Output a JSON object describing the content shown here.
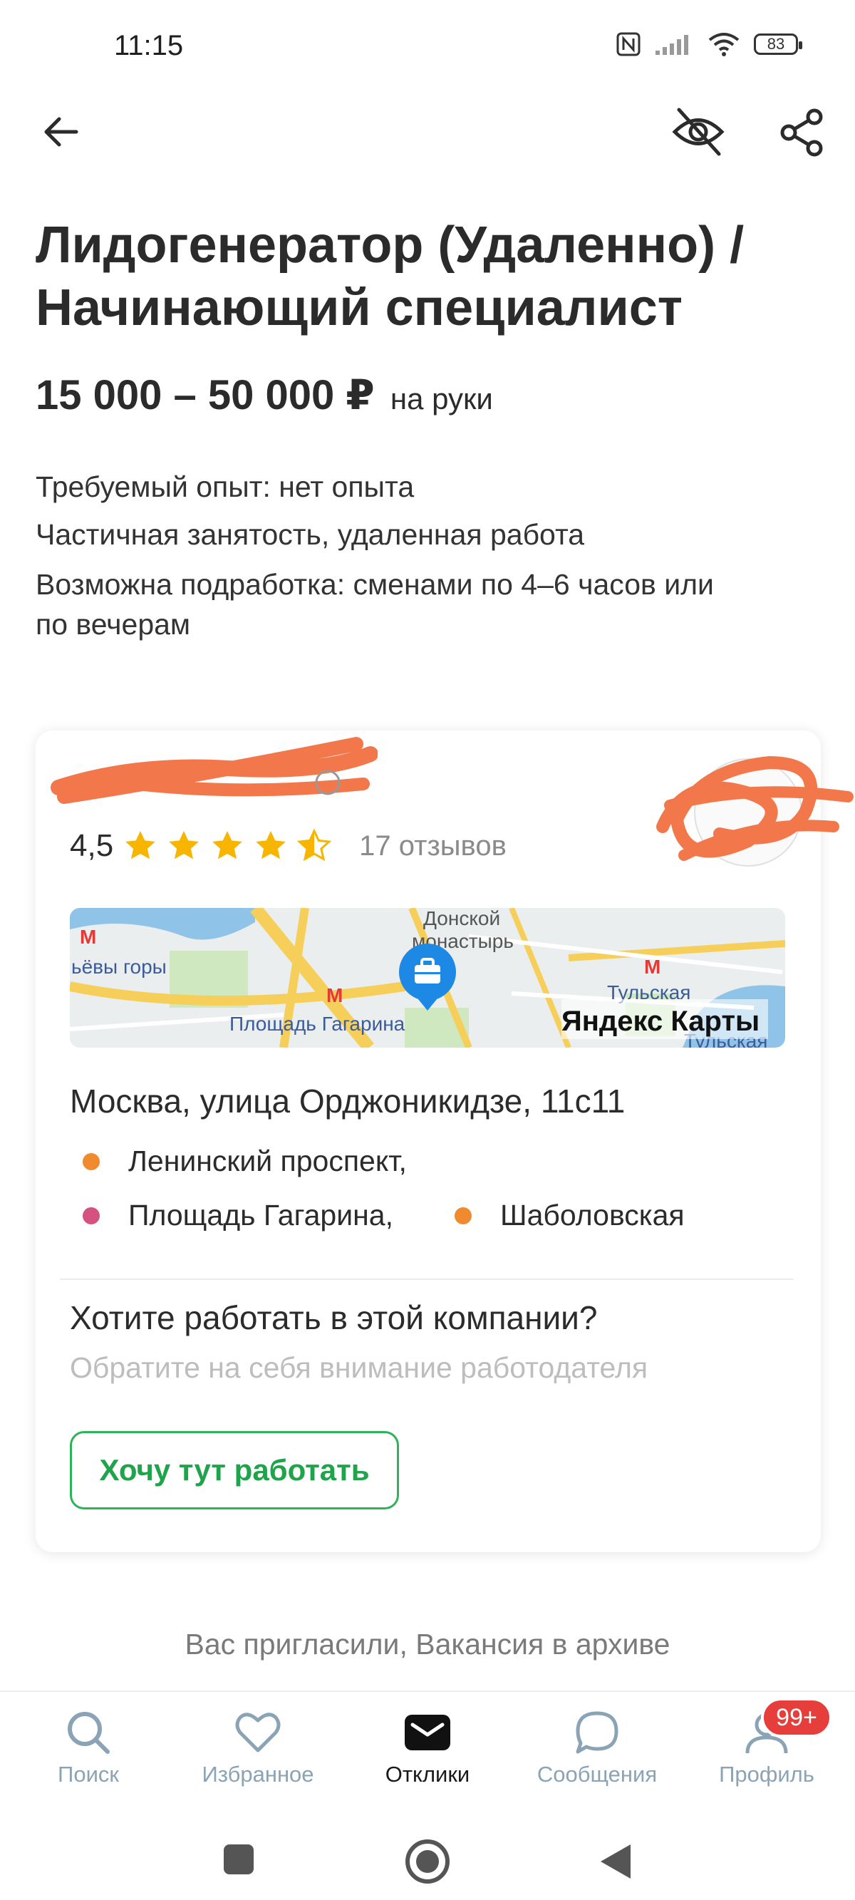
{
  "status_bar": {
    "time": "11:15",
    "battery": "83"
  },
  "header": {
    "back_icon": "arrow-left-icon",
    "hide_icon": "eye-off-icon",
    "share_icon": "share-icon"
  },
  "vacancy": {
    "title_line1": "Лидогенератор (Удаленно) /",
    "title_line2": "Начинающий специалист",
    "salary": "15 000 – 50 000 ₽",
    "salary_note": "на руки",
    "experience": "Требуемый опыт: нет опыта",
    "employment": "Частичная занятость, удаленная работа",
    "side_job_line1": "Возможна подработка: сменами по 4–6 часов или",
    "side_job_line2": "по вечерам"
  },
  "company": {
    "rating": "4,5",
    "stars": 4.5,
    "reviews": "17 отзывов",
    "map": {
      "labels": [
        "Донской",
        "монастырь",
        "ьёвы горы",
        "Площадь Гагарина",
        "Тульская",
        "Тульская"
      ],
      "brand": "Яндекс Карты"
    },
    "address": "Москва, улица Орджоникидзе, 11с11",
    "metro": [
      {
        "name": "Ленинский проспект,",
        "color": "#f08a2e"
      },
      {
        "name": "Площадь Гагарина,",
        "color": "#d4527d"
      },
      {
        "name": "Шаболовская",
        "color": "#f08a2e"
      }
    ],
    "cta_question": "Хотите работать в этой компании?",
    "cta_hint": "Обратите на себя внимание работодателя",
    "cta_button": "Хочу тут работать"
  },
  "footer_note": "Вас пригласили, Вакансия в архиве",
  "tabs": [
    {
      "label": "Поиск",
      "icon": "search-icon",
      "active": false
    },
    {
      "label": "Избранное",
      "icon": "heart-icon",
      "active": false
    },
    {
      "label": "Отклики",
      "icon": "envelope-icon",
      "active": true
    },
    {
      "label": "Сообщения",
      "icon": "chat-bubble-icon",
      "active": false
    },
    {
      "label": "Профиль",
      "icon": "profile-icon",
      "active": false
    }
  ],
  "profile_badge": "99+",
  "colors": {
    "accent_green": "#1fa34b",
    "badge_red": "#e63e3a",
    "tab_inactive": "#8aa3b5",
    "scribble_orange": "#f2784b"
  }
}
